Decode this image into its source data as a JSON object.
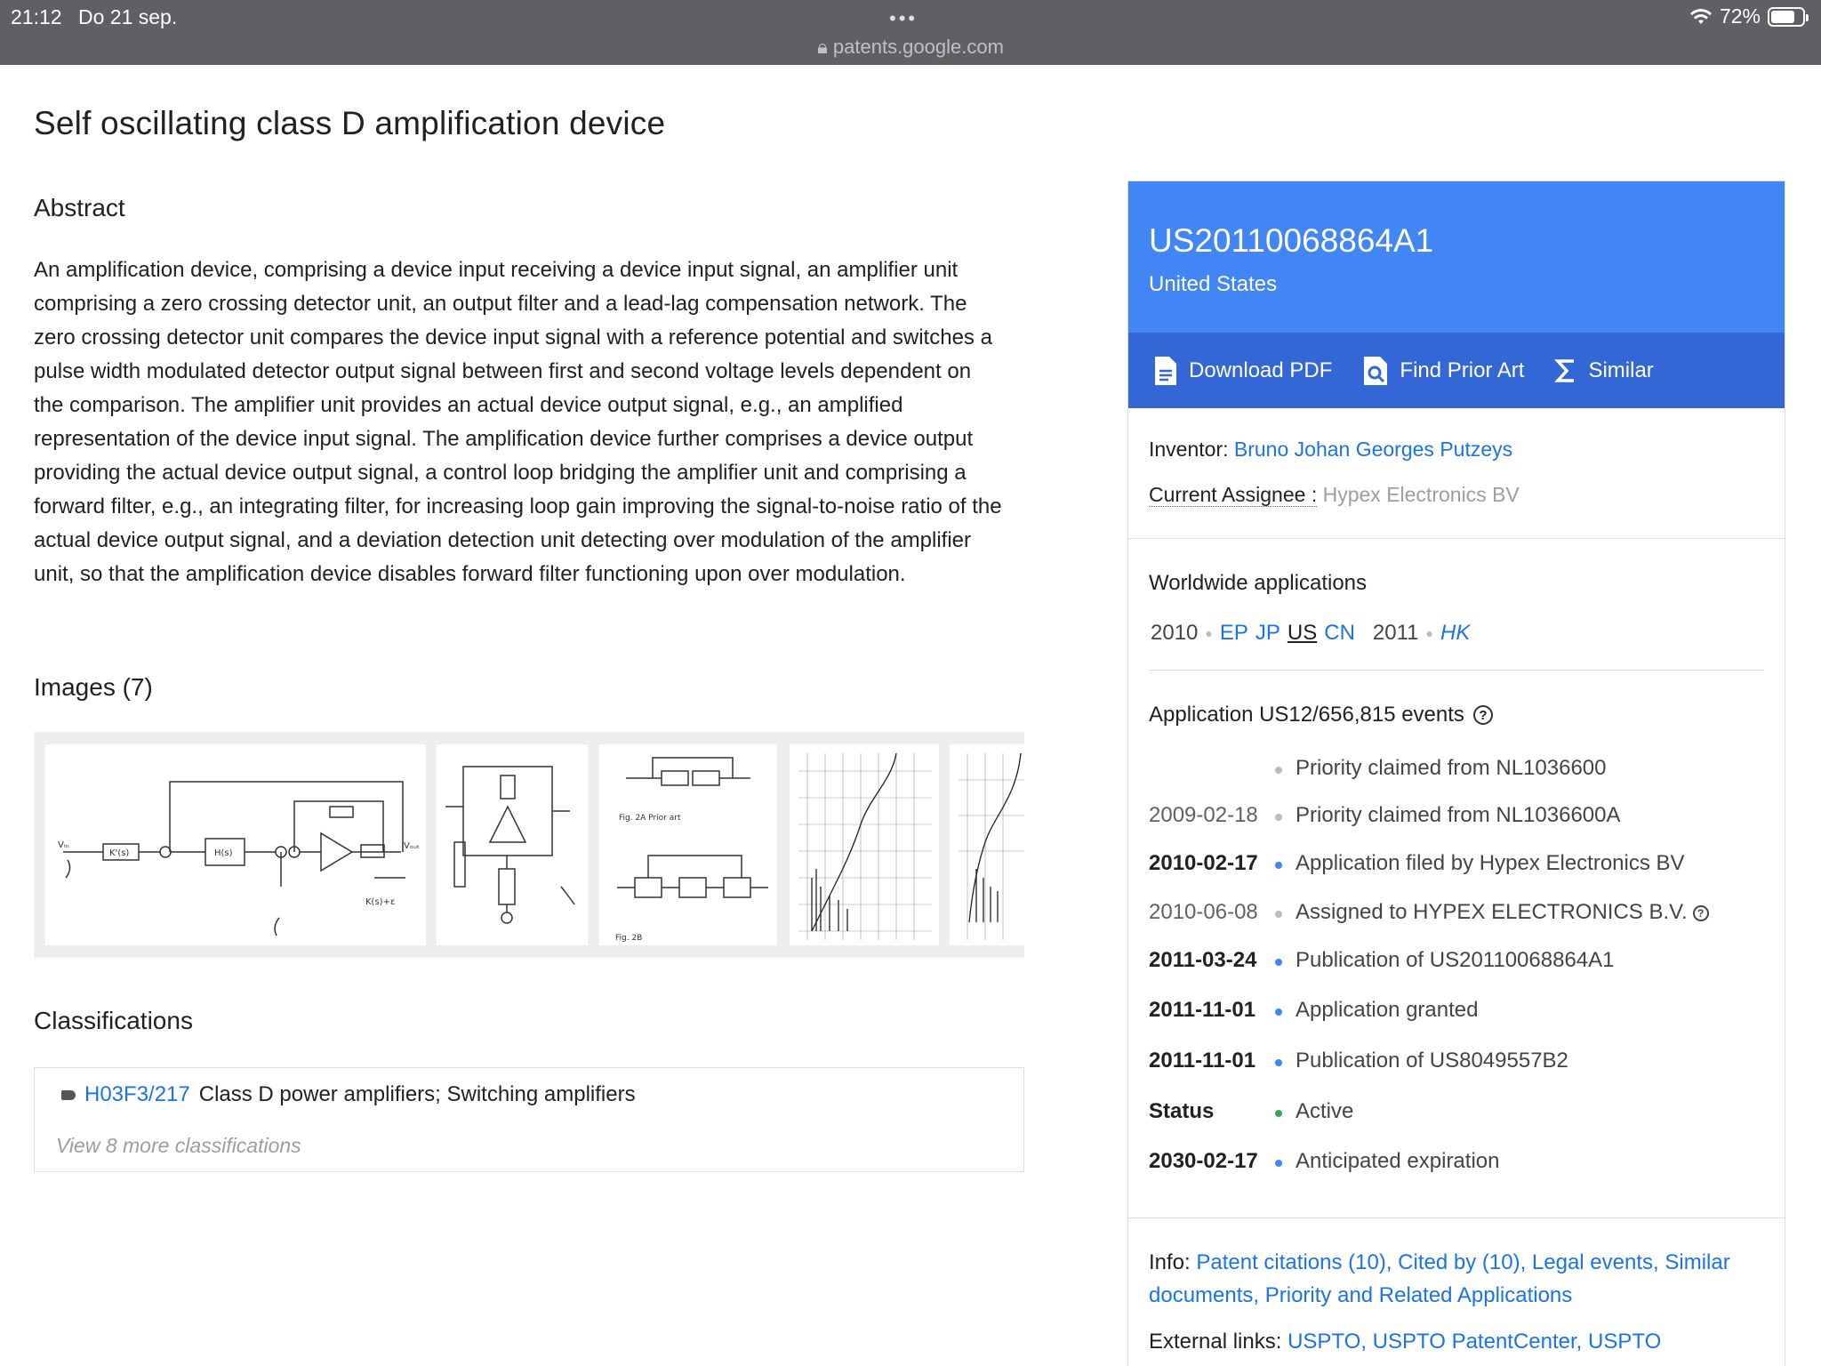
{
  "status_bar": {
    "time": "21:12",
    "date": "Do 21 sep.",
    "dots": "•••",
    "url": "patents.google.com",
    "battery": "72%"
  },
  "page": {
    "title": "Self oscillating class D amplification device"
  },
  "abstract": {
    "heading": "Abstract",
    "text": "An amplification device, comprising a device input receiving a device input signal, an amplifier unit comprising a zero crossing detector unit, an output filter and a lead-lag compensation network. The zero crossing detector unit compares the device input signal with a reference potential and switches a pulse width modulated detector output signal between first and second voltage levels dependent on the comparison. The amplifier unit provides an actual device output signal, e.g., an amplified representation of the device input signal. The amplification device further comprises a device output providing the actual device output signal, a control loop bridging the amplifier unit and comprising a forward filter, e.g., an integrating filter, for increasing loop gain improving the signal-to-noise ratio of the actual device output signal, and a deviation detection unit detecting over modulation of the amplifier unit, so that the amplification device disables forward filter functioning upon over modulation."
  },
  "images": {
    "heading": "Images (7)"
  },
  "classifications": {
    "heading": "Classifications",
    "code": "H03F3/217",
    "description": "Class D power amplifiers; Switching amplifiers",
    "view_more": "View 8 more classifications"
  },
  "card": {
    "pub_number": "US20110068864A1",
    "country": "United States",
    "actions": {
      "download": "Download PDF",
      "prior_art": "Find Prior Art",
      "similar": "Similar"
    },
    "inventor_label": "Inventor:",
    "inventor": "Bruno Johan Georges Putzeys",
    "assignee_label": "Current Assignee :",
    "assignee": "Hypex Electronics BV",
    "worldwide": {
      "heading": "Worldwide applications",
      "year1": "2010",
      "codes1": [
        "EP",
        "JP",
        "US",
        "CN"
      ],
      "year2": "2011",
      "codes2": [
        "HK"
      ]
    },
    "events_heading": "Application US12/656,815 events",
    "events": [
      {
        "date": "",
        "text": "Priority claimed from NL1036600"
      },
      {
        "date": "2009-02-18",
        "text": "Priority claimed from NL1036600A"
      },
      {
        "date": "2010-02-17",
        "text": "Application filed by Hypex Electronics BV"
      },
      {
        "date": "2010-06-08",
        "text": "Assigned to HYPEX ELECTRONICS B.V."
      },
      {
        "date": "2011-03-24",
        "text": "Publication of US20110068864A1"
      },
      {
        "date": "2011-11-01",
        "text": "Application granted"
      },
      {
        "date": "2011-11-01",
        "text": "Publication of US8049557B2"
      },
      {
        "date": "Status",
        "text": "Active"
      },
      {
        "date": "2030-02-17",
        "text": "Anticipated expiration"
      }
    ],
    "info": {
      "label": "Info:",
      "links": [
        "Patent citations (10)",
        "Cited by (10)",
        "Legal events",
        "Similar documents",
        "Priority and Related Applications"
      ]
    },
    "external": {
      "label": "External links:",
      "links": [
        "USPTO",
        "USPTO PatentCenter",
        "USPTO"
      ]
    }
  },
  "colors": {
    "header_blue": "#4285f4",
    "action_blue": "#3367d6",
    "link": "#1a73e8",
    "active_green": "#34a853"
  }
}
